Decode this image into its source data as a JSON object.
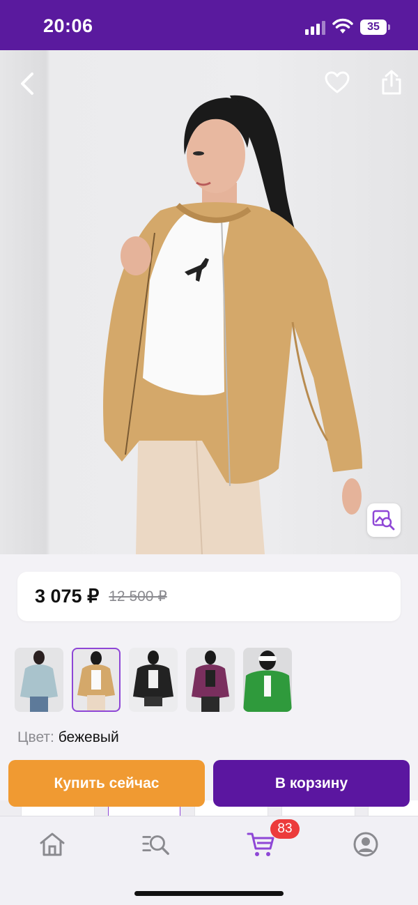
{
  "status_bar": {
    "time": "20:06",
    "battery": "35"
  },
  "product": {
    "price": "3 075 ₽",
    "old_price": "12 500 ₽",
    "color_label": "Цвет:",
    "color_value": "бежевый",
    "selected_variant": "beige",
    "variants": [
      "mint",
      "beige",
      "black",
      "plum",
      "green"
    ]
  },
  "actions": {
    "buy_now": "Купить сейчас",
    "add_to_cart": "В корзину"
  },
  "nav": {
    "cart_badge": "83"
  },
  "colors": {
    "brand": "#5a1a9e",
    "buy_now": "#f09a32",
    "cart_button": "#5b16a0",
    "badge": "#ec3b3b"
  },
  "icons": [
    "back-icon",
    "heart-icon",
    "share-icon",
    "image-search-icon",
    "home-icon",
    "catalog-search-icon",
    "cart-icon",
    "profile-icon"
  ]
}
